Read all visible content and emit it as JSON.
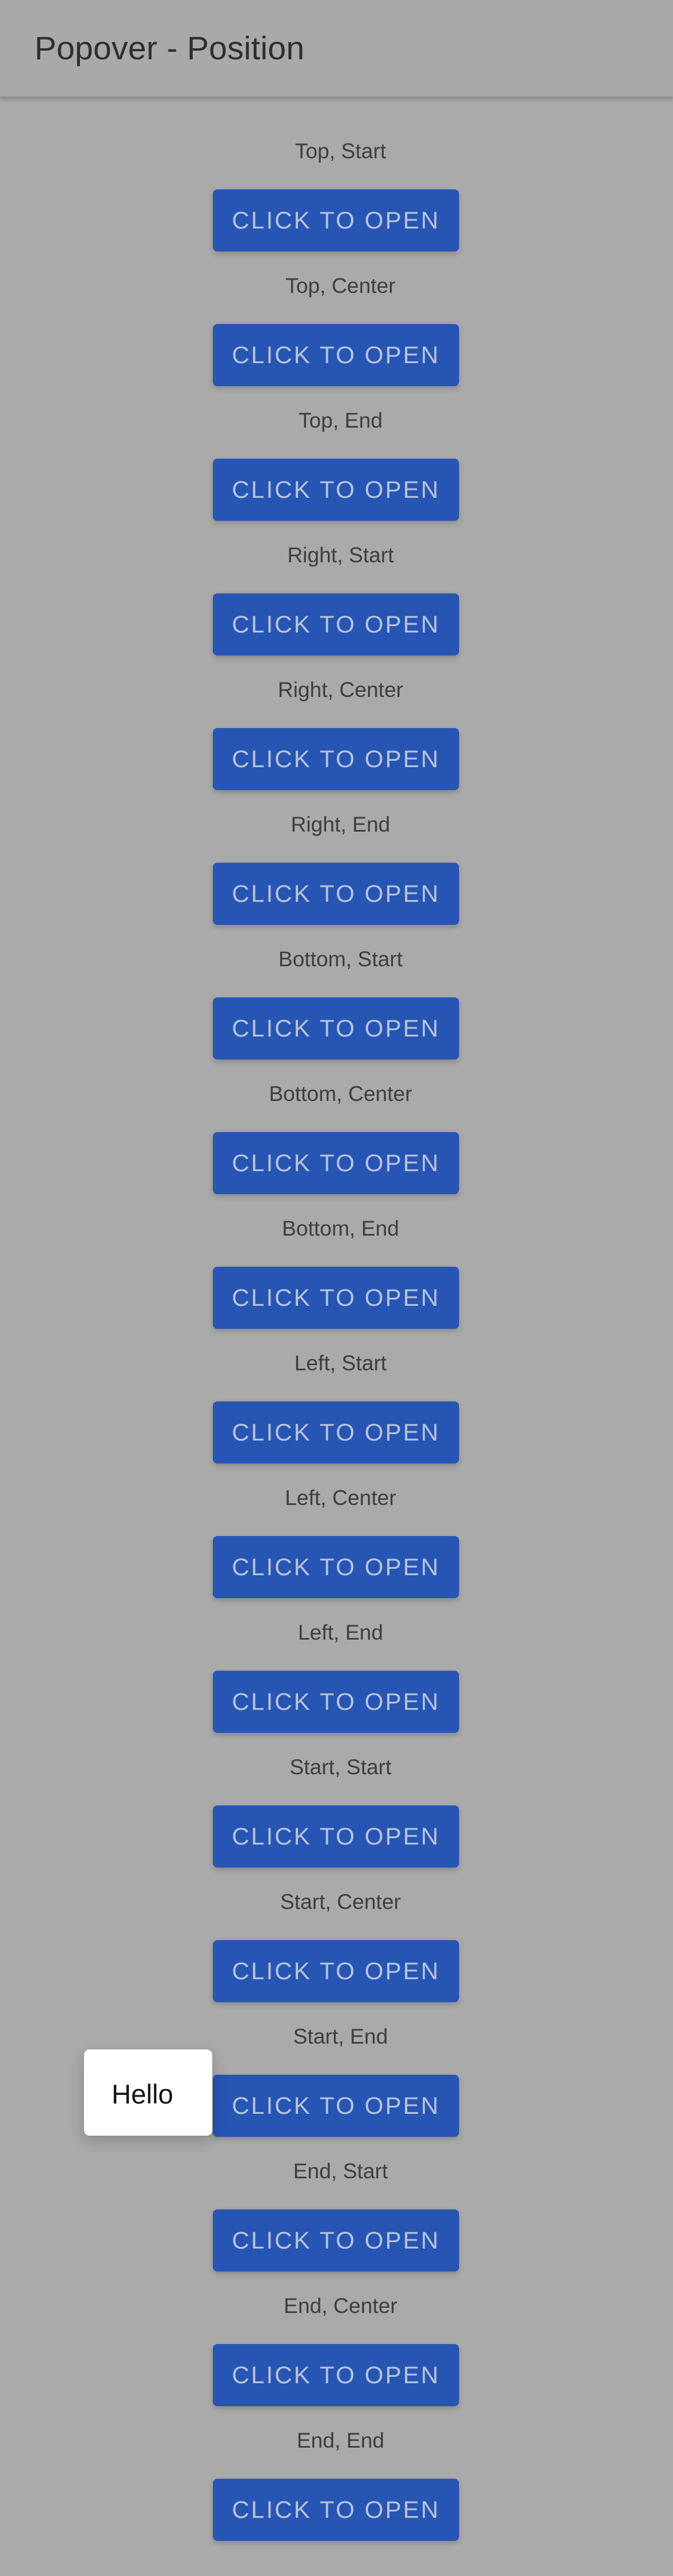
{
  "app_bar": {
    "title": "Popover - Position"
  },
  "positions": [
    {
      "label": "Top, Start",
      "button_label": "CLICK TO OPEN"
    },
    {
      "label": "Top, Center",
      "button_label": "CLICK TO OPEN"
    },
    {
      "label": "Top, End",
      "button_label": "CLICK TO OPEN"
    },
    {
      "label": "Right, Start",
      "button_label": "CLICK TO OPEN"
    },
    {
      "label": "Right, Center",
      "button_label": "CLICK TO OPEN"
    },
    {
      "label": "Right, End",
      "button_label": "CLICK TO OPEN"
    },
    {
      "label": "Bottom, Start",
      "button_label": "CLICK TO OPEN"
    },
    {
      "label": "Bottom, Center",
      "button_label": "CLICK TO OPEN"
    },
    {
      "label": "Bottom, End",
      "button_label": "CLICK TO OPEN"
    },
    {
      "label": "Left, Start",
      "button_label": "CLICK TO OPEN"
    },
    {
      "label": "Left, Center",
      "button_label": "CLICK TO OPEN"
    },
    {
      "label": "Left, End",
      "button_label": "CLICK TO OPEN"
    },
    {
      "label": "Start, Start",
      "button_label": "CLICK TO OPEN"
    },
    {
      "label": "Start, Center",
      "button_label": "CLICK TO OPEN"
    },
    {
      "label": "Start, End",
      "button_label": "CLICK TO OPEN"
    },
    {
      "label": "End, Start",
      "button_label": "CLICK TO OPEN"
    },
    {
      "label": "End, Center",
      "button_label": "CLICK TO OPEN"
    },
    {
      "label": "End, End",
      "button_label": "CLICK TO OPEN"
    }
  ],
  "popover": {
    "text": "Hello"
  },
  "colors": {
    "page_background": "#aaaaaa",
    "button_background": "#2755b4",
    "button_text": "#b7c3dc",
    "label_text": "#3e3e3e",
    "title_text": "#2f2f2f",
    "popover_background": "#ffffff"
  }
}
